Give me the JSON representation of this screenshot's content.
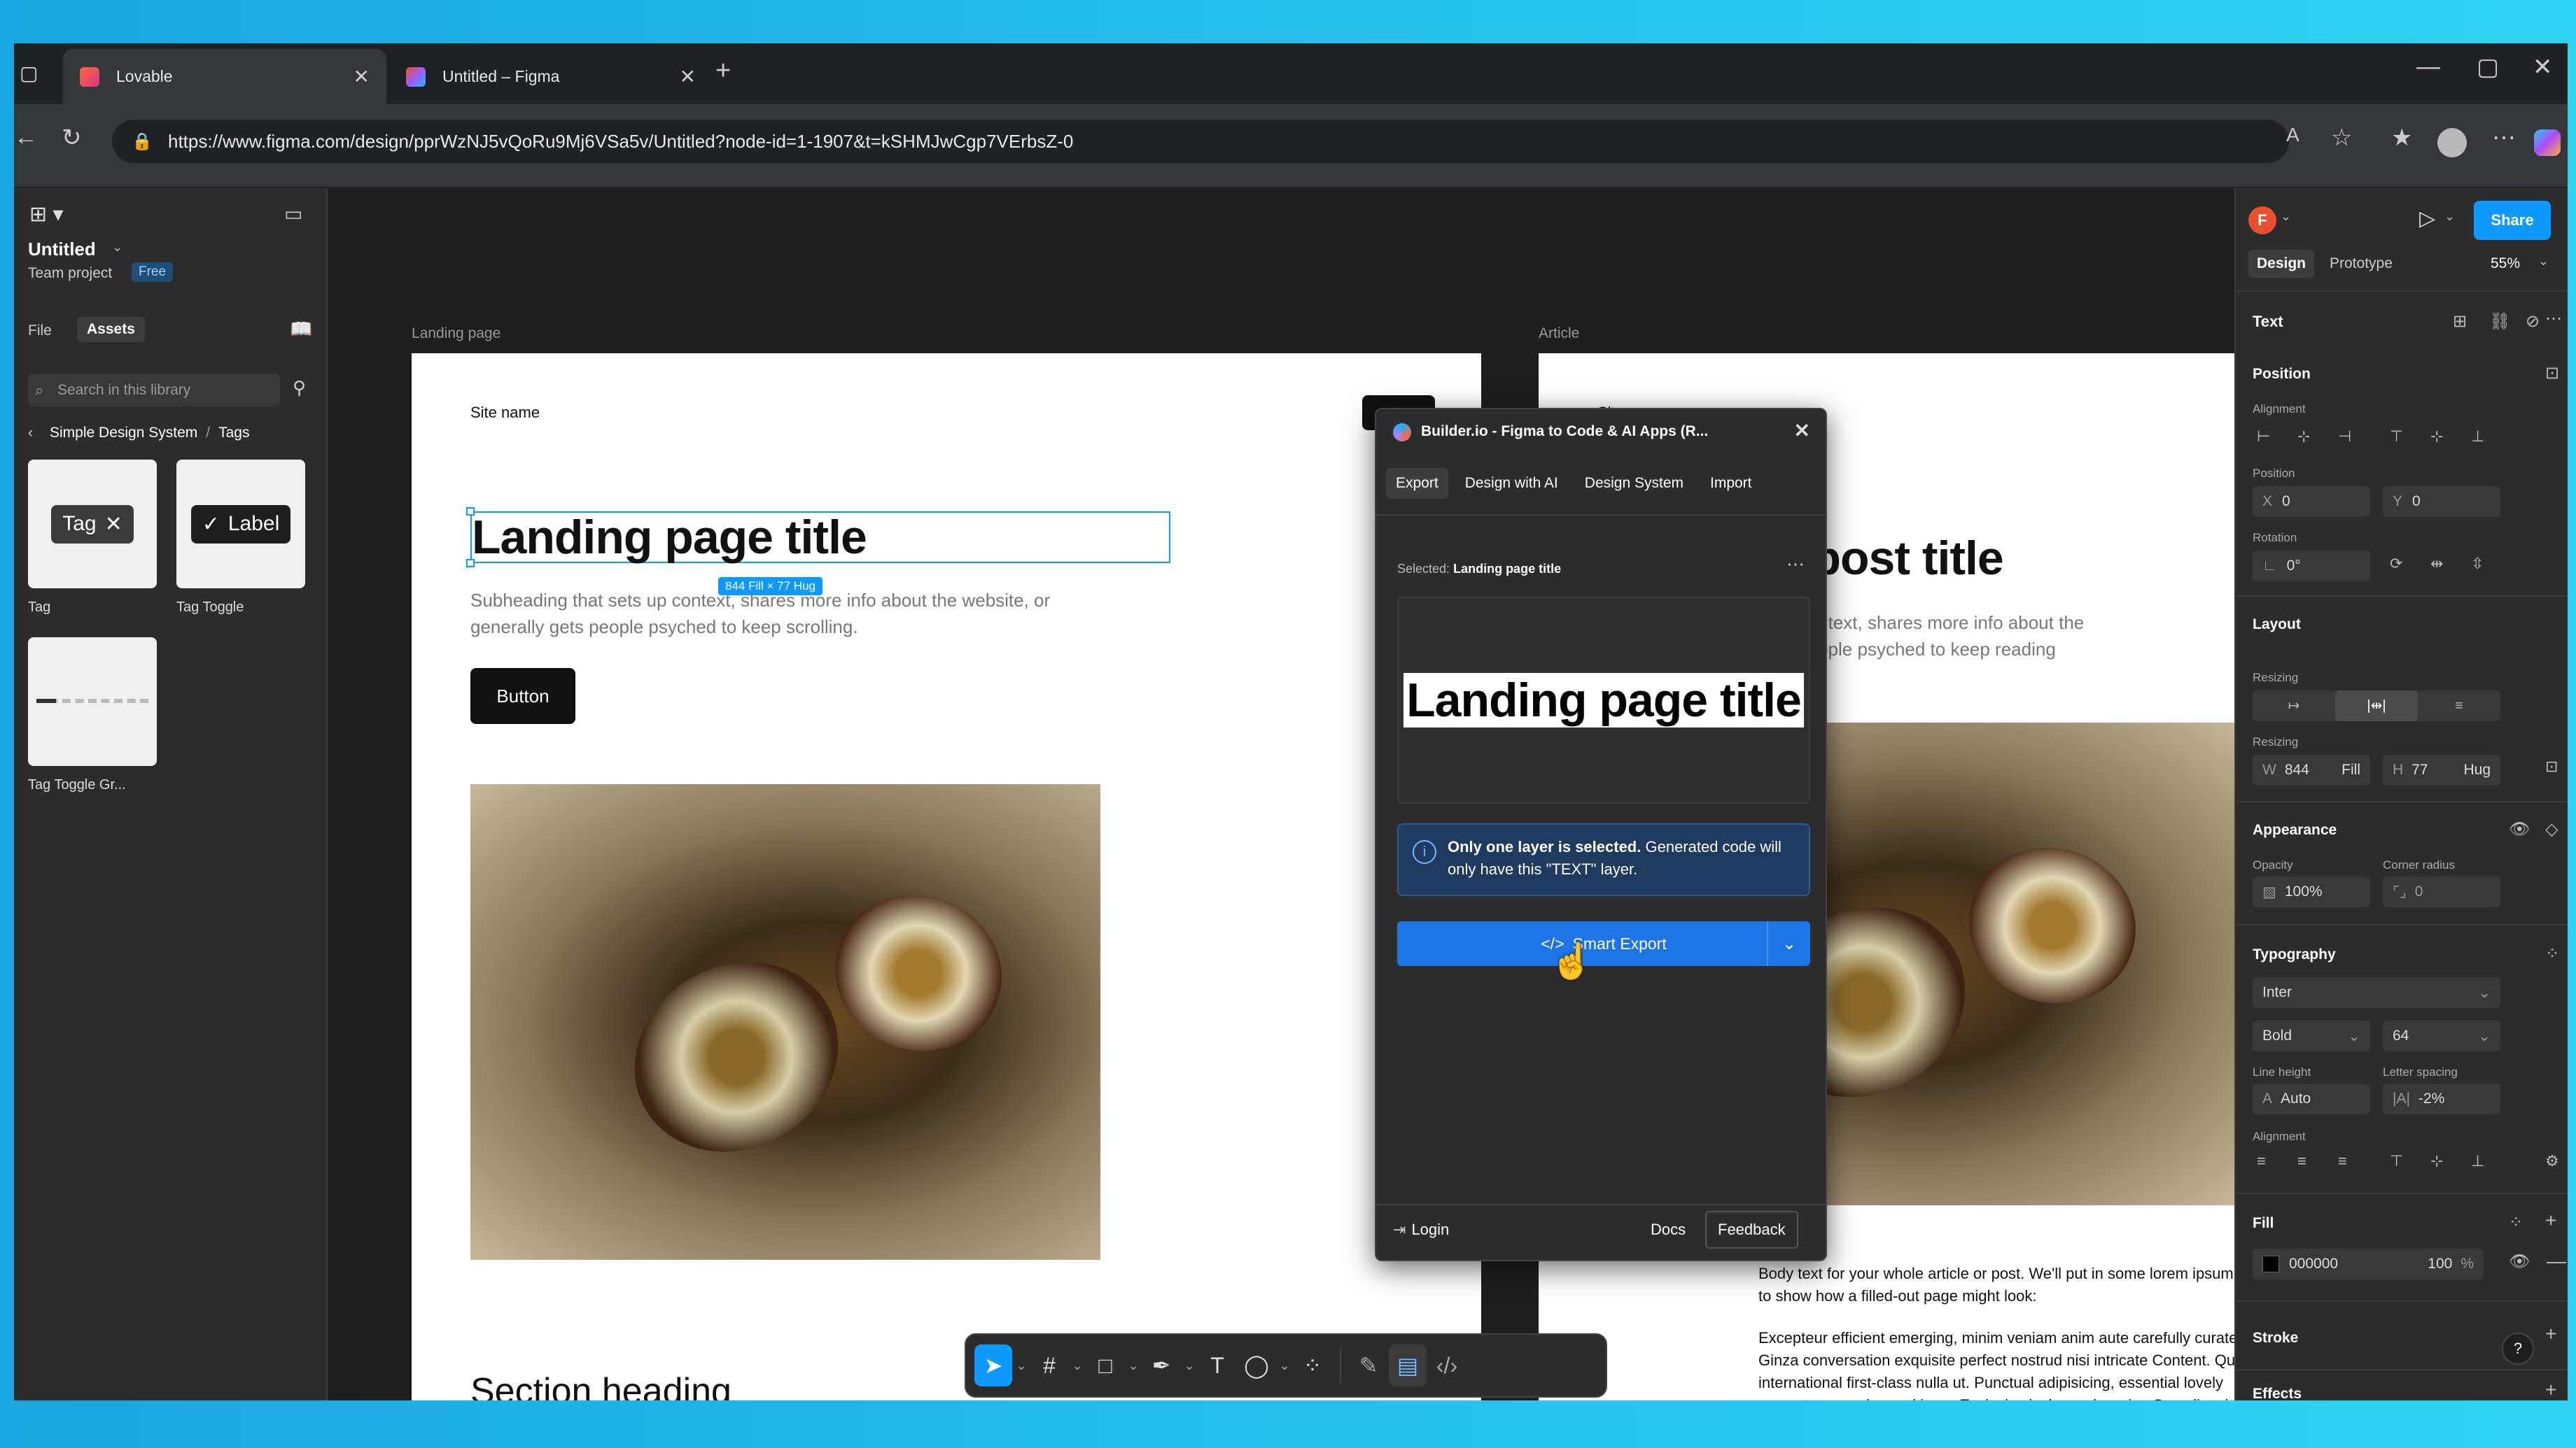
{
  "browser": {
    "tabs": [
      {
        "label": "Lovable"
      },
      {
        "label": "Untitled – Figma"
      }
    ],
    "url": "https://www.figma.com/design/pprWzNJ5vQoRu9Mj6VSa5v/Untitled?node-id=1-1907&t=kSHMJwCgp7VErbsZ-0"
  },
  "left": {
    "file_name": "Untitled",
    "team": "Team project",
    "plan_badge": "Free",
    "tab_file": "File",
    "tab_assets": "Assets",
    "search_placeholder": "Search in this library",
    "breadcrumb_root": "Simple Design System",
    "breadcrumb_sep": "/",
    "breadcrumb_leaf": "Tags",
    "assets": [
      {
        "name": "Tag",
        "preview": "Tag"
      },
      {
        "name": "Tag Toggle",
        "preview": "Label"
      },
      {
        "name": "Tag Toggle Gr..."
      }
    ]
  },
  "canvas": {
    "frame1_label": "Landing page",
    "frame2_label": "Article",
    "site_name": "Site name",
    "landing_title": "Landing page title",
    "dim_badge": "844 Fill × 77 Hug",
    "subheading": "Subheading that sets up context, shares more info about the website, or generally gets people psyched to keep scrolling.",
    "button_label": "Button",
    "section_heading": "Section heading",
    "article_title": "Article or post title",
    "article_sub": "Subheading that sets up context, shares more info about the author, or generally gets people psyched to keep reading",
    "body1": "Body text for your whole article or post. We'll put in some lorem ipsum to show how a filled-out page might look:",
    "body2": "Excepteur efficient emerging, minim veniam anim aute carefully curated Ginza conversation exquisite perfect nostrud nisi intricate Content. Qui  international first-class nulla ut. Punctual adipisicing, essential lovely queen tempor eiusmod irure. Exclusive izakaya charming Scandinavian impeccable aute quality of life soft power pariatur Melbourne occaecat discerning. Qui wardrobe aliquip, et Porter destination"
  },
  "plugin": {
    "title": "Builder.io - Figma to Code & AI Apps (R...",
    "tabs": [
      "Export",
      "Design with AI",
      "Design System",
      "Import"
    ],
    "selected_label": "Selected:",
    "selected_value": "Landing page title",
    "preview_text": "Landing page title",
    "info_bold": "Only one layer is selected.",
    "info_rest": "Generated code will only have this \"TEXT\" layer.",
    "export_button": "Smart Export",
    "login": "Login",
    "docs": "Docs",
    "feedback": "Feedback"
  },
  "right": {
    "avatar": "F",
    "share": "Share",
    "tab_design": "Design",
    "tab_prototype": "Prototype",
    "zoom": "55%",
    "layer_type": "Text",
    "position_title": "Position",
    "alignment_label": "Alignment",
    "position_label": "Position",
    "x_label": "X",
    "x_value": "0",
    "y_label": "Y",
    "y_value": "0",
    "rotation_label": "Rotation",
    "rotation_value": "0°",
    "layout_title": "Layout",
    "resizing_label": "Resizing",
    "resizing_label2": "Resizing",
    "w_label": "W",
    "w_value": "844",
    "w_mode": "Fill",
    "h_label": "H",
    "h_value": "77",
    "h_mode": "Hug",
    "appearance_title": "Appearance",
    "opacity_label": "Opacity",
    "opacity_value": "100%",
    "corner_label": "Corner radius",
    "corner_value": "0",
    "typography_title": "Typography",
    "font_family": "Inter",
    "font_weight": "Bold",
    "font_size": "64",
    "line_height_label": "Line height",
    "line_height_value": "Auto",
    "letter_spacing_label": "Letter spacing",
    "letter_spacing_value": "-2%",
    "text_align_label": "Alignment",
    "fill_title": "Fill",
    "fill_hex": "000000",
    "fill_opacity": "100",
    "fill_pct": "%",
    "stroke_title": "Stroke",
    "effects_title": "Effects"
  },
  "colors": {
    "accent": "#0d99ff",
    "plugin_blue": "#1d74e6",
    "info_bg": "#1e3a5f",
    "avatar": "#e8502f"
  }
}
